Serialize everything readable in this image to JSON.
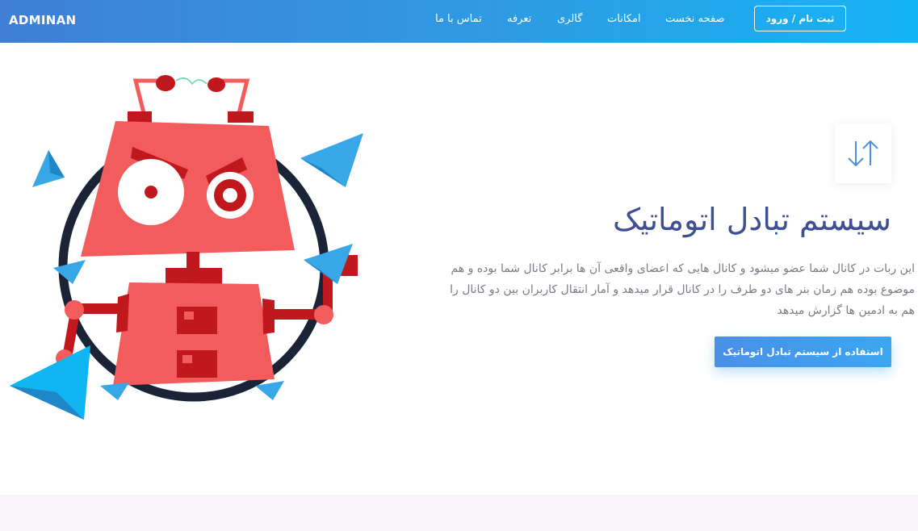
{
  "header": {
    "brand": "ADMINAN",
    "nav": [
      {
        "label": "صفحه نخست"
      },
      {
        "label": "امکانات"
      },
      {
        "label": "گالری"
      },
      {
        "label": "تعرفه"
      },
      {
        "label": "تماس با ما"
      }
    ],
    "auth_label": "ثبت نام / ورود"
  },
  "hero": {
    "icon": "swap-arrows-icon",
    "title": "سیستم تبادل اتوماتیک",
    "description": "این ربات در کانال شما عضو میشود و کانال هایی که اعضای واقعی آن ها برابر کانال شما بوده و هم موضوع بوده هم زمان بنر های دو طرف را در کانال قرار میدهد و آمار انتقال کاربران بین دو کانال را هم به ادمین ها گزارش میدهد",
    "cta_label": "استفاده از سیستم تبادل اتوماتیک",
    "illustration": "robot-with-paper-planes"
  },
  "colors": {
    "header_start": "#3f7fd6",
    "header_end": "#14b4f4",
    "title": "#3e4f93",
    "robot": "#f25c5c",
    "robot_dark": "#c0181c",
    "accent": "#3ba7f0"
  }
}
